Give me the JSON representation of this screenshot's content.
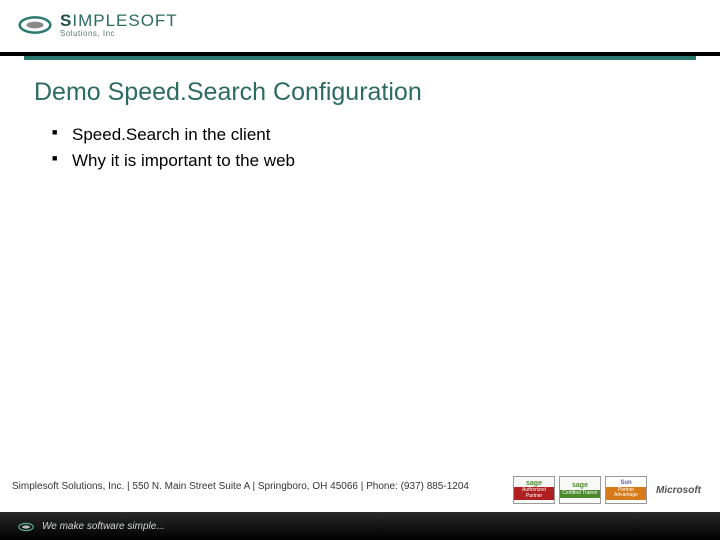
{
  "brand": {
    "name_prefix": "S",
    "name_rest": "IMPLESOFT",
    "subtitle": "Solutions, Inc",
    "tagline": "We make software simple..."
  },
  "slide": {
    "title": "Demo Speed.Search Configuration",
    "bullets": [
      "Speed.Search in the client",
      "Why it is important to the web"
    ]
  },
  "footer": {
    "contact": "Simplesoft Solutions, Inc.  |  550 N. Main Street Suite A  |  Springboro, OH 45066  |  Phone: (937) 885-1204"
  },
  "badges": {
    "sage1_top": "sage",
    "sage1_bot": "Authorized Partner",
    "sage2_top": "sage",
    "sage2_bot": "Certified Trainer",
    "sun_top": "Sun",
    "sun_bot": "Partner Advantage",
    "ms": "Microsoft"
  }
}
